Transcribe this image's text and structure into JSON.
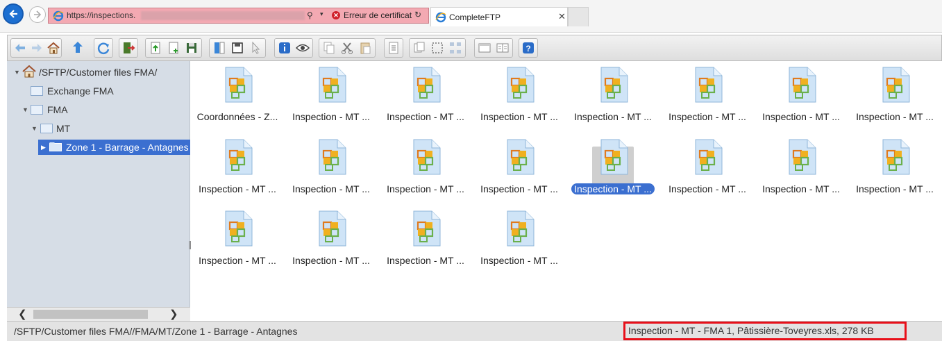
{
  "browser": {
    "url": "https://inspections.",
    "cert_error": "Erreur de certificat",
    "tab_title": "CompleteFTP",
    "tab_close": "✕",
    "search_glyph": "⚲",
    "dropdown_glyph": "▾",
    "refresh_glyph": "↻",
    "cert_glyph": "✕"
  },
  "toolbar": {
    "buttons": [
      "back-arrow-icon",
      "forward-arrow-icon",
      "home-icon",
      "up-arrow-icon",
      "refresh-icon",
      "exit-icon",
      "upload-icon",
      "new-file-icon",
      "save-icon",
      "split-icon",
      "disk-icon",
      "pointer-icon",
      "info-icon",
      "preview-eye-icon",
      "copy-icon",
      "cut-icon",
      "paste-icon",
      "properties-icon",
      "select-all-icon",
      "select-icon",
      "tree-icon",
      "window-icon",
      "book-icon",
      "help-icon"
    ]
  },
  "tree": {
    "root": "/SFTP/Customer files FMA/",
    "items": [
      {
        "label": "Exchange FMA"
      },
      {
        "label": "FMA"
      },
      {
        "label": "MT"
      },
      {
        "label": "Zone 1 - Barrage - Antagnes"
      }
    ]
  },
  "scroll": {
    "left": "❮",
    "right": "❯"
  },
  "files": [
    {
      "name": "Coordonnées - Z..."
    },
    {
      "name": "Inspection - MT ..."
    },
    {
      "name": "Inspection - MT ..."
    },
    {
      "name": "Inspection - MT ..."
    },
    {
      "name": "Inspection - MT ..."
    },
    {
      "name": "Inspection - MT ..."
    },
    {
      "name": "Inspection - MT ..."
    },
    {
      "name": "Inspection - MT ..."
    },
    {
      "name": "Inspection - MT ..."
    },
    {
      "name": "Inspection - MT ..."
    },
    {
      "name": "Inspection - MT ..."
    },
    {
      "name": "Inspection - MT ..."
    },
    {
      "name": "Inspection - MT ...",
      "selected": true
    },
    {
      "name": "Inspection - MT ..."
    },
    {
      "name": "Inspection - MT ..."
    },
    {
      "name": "Inspection - MT ..."
    },
    {
      "name": "Inspection - MT ..."
    },
    {
      "name": "Inspection - MT ..."
    },
    {
      "name": "Inspection - MT ..."
    },
    {
      "name": "Inspection - MT ..."
    }
  ],
  "status": {
    "path": "/SFTP/Customer files FMA//FMA/MT/Zone 1 - Barrage - Antagnes",
    "file_info": "Inspection - MT - FMA 1, Pâtissière-Toveyres.xls, 278 KB"
  },
  "colors": {
    "accent": "#3b6fd0",
    "highlight_box": "#e8101a",
    "address_bg": "#f3a9b2"
  }
}
